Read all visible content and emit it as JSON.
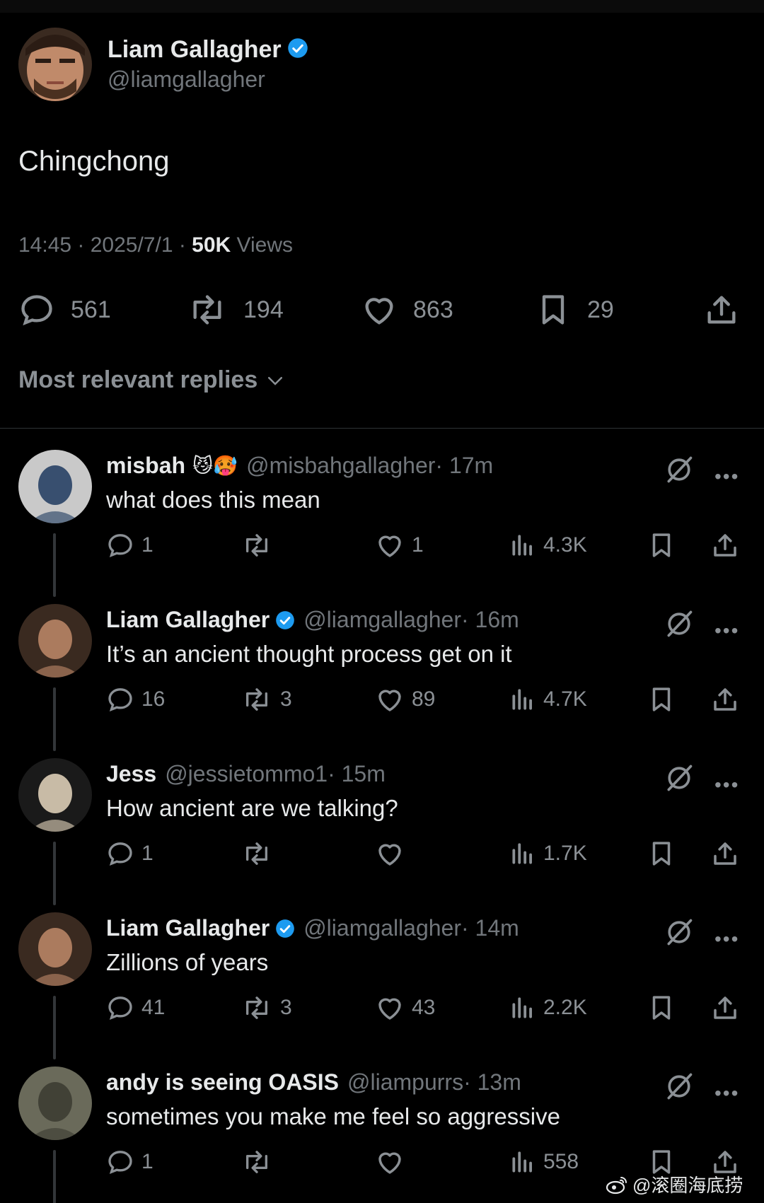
{
  "main": {
    "author_name": "Liam Gallagher",
    "author_handle": "@liamgallagher",
    "text": "Chingchong",
    "time": "14:45 · 2025/7/1 · ",
    "views_count": "50K",
    "views_label": " Views",
    "replies": "561",
    "reposts": "194",
    "likes": "863",
    "bookmarks": "29"
  },
  "sort_label": "Most relevant replies",
  "replies": [
    {
      "name": "misbah",
      "emoji": "😼🥵",
      "handle": "@misbahgallagher",
      "time": " · 17m",
      "text": "what does this mean",
      "replies": "1",
      "reposts": "",
      "likes": "1",
      "views": "4.3K",
      "verified": false
    },
    {
      "name": "Liam Gallagher",
      "emoji": "",
      "handle": "@liamgallagher",
      "time": " · 16m",
      "text": "It’s an ancient thought process get on it",
      "replies": "16",
      "reposts": "3",
      "likes": "89",
      "views": "4.7K",
      "verified": true
    },
    {
      "name": "Jess",
      "emoji": "",
      "handle": "@jessietommo1",
      "time": " · 15m",
      "text": "How ancient are we talking?",
      "replies": "1",
      "reposts": "",
      "likes": "",
      "views": "1.7K",
      "verified": false
    },
    {
      "name": "Liam Gallagher",
      "emoji": "",
      "handle": "@liamgallagher",
      "time": " · 14m",
      "text": "Zillions of years",
      "replies": "41",
      "reposts": "3",
      "likes": "43",
      "views": "2.2K",
      "verified": true
    },
    {
      "name": "andy is seeing OASIS",
      "emoji": "",
      "handle": "@liampurrs",
      "time": " · 13m",
      "text": "sometimes you make me feel so aggressive",
      "replies": "1",
      "reposts": "",
      "likes": "",
      "views": "558",
      "verified": false
    }
  ],
  "watermark": "@滚圈海底捞",
  "colors": {
    "verified": "#1d9bf0",
    "muted": "#71767b",
    "text": "#e7e9ea",
    "background": "#000000"
  },
  "icons": [
    "reply-icon",
    "repost-icon",
    "like-icon",
    "bookmark-icon",
    "share-icon",
    "views-icon",
    "grok-icon",
    "more-icon",
    "verified-icon",
    "chevron-down-icon",
    "weibo-icon"
  ]
}
